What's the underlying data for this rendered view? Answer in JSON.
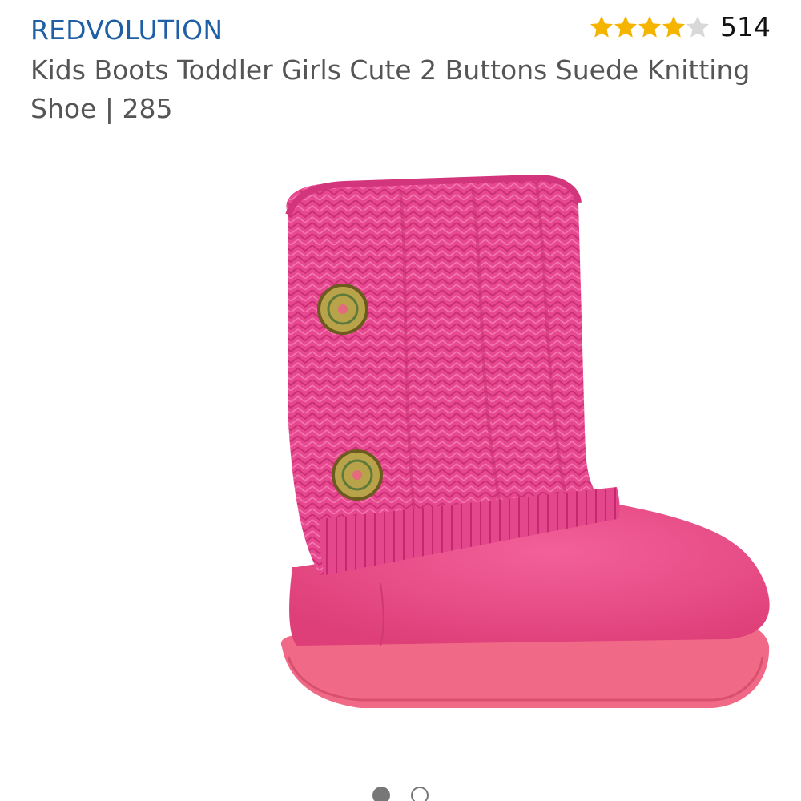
{
  "product": {
    "brand": "REDVOLUTION",
    "title": "Kids Boots Toddler Girls Cute 2 Buttons Suede Knitting Shoe | 285",
    "rating": {
      "stars": 4,
      "max_stars": 5,
      "count": "514",
      "star_color": "#f5b400",
      "star_empty_color": "#d8d8d8"
    },
    "image": {
      "icon": "pink-knit-boot-photo",
      "colors": {
        "knit": "#e8488f",
        "suede": "#ec4f86",
        "sole": "#f06a88",
        "button": "#b8a24a"
      }
    }
  },
  "carousel": {
    "total": 2,
    "active_index": 0
  }
}
